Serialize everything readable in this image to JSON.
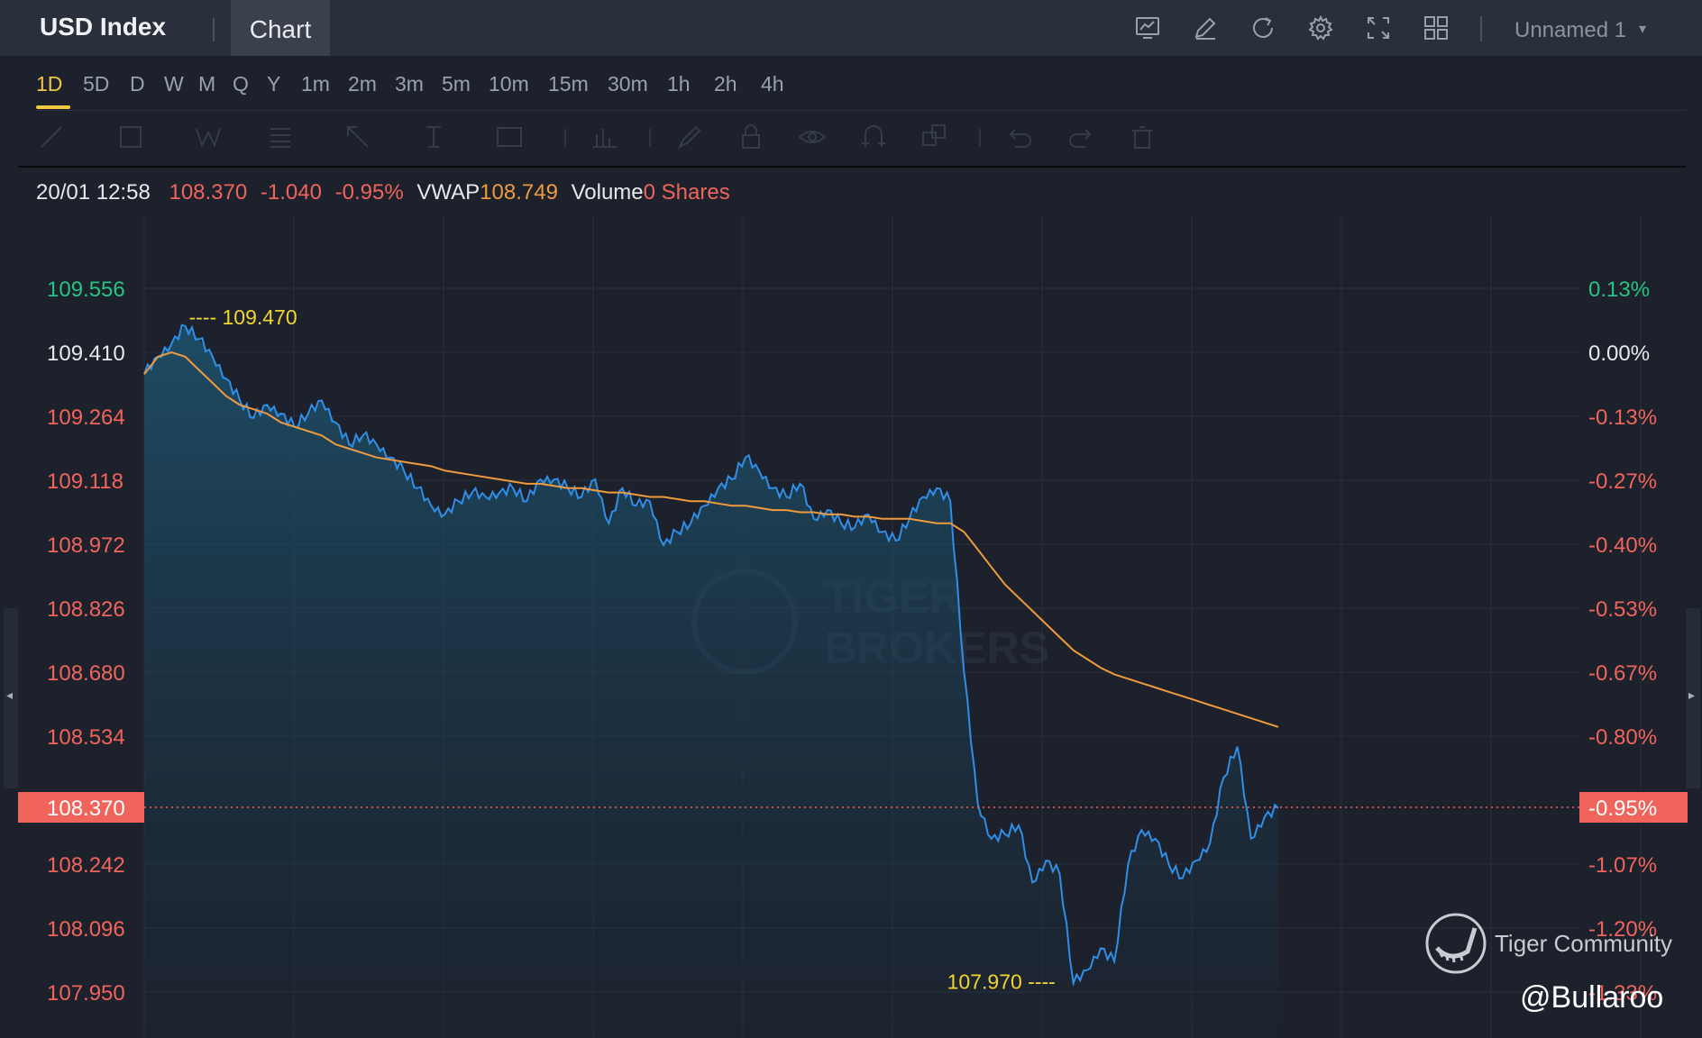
{
  "header": {
    "title": "USD Index",
    "tab_label": "Chart",
    "layout_name": "Unnamed 1",
    "icons": [
      "chart-template-icon",
      "pencil-icon",
      "refresh-icon",
      "settings-icon",
      "fullscreen-icon",
      "grid-layout-icon"
    ]
  },
  "timeframes": [
    "1D",
    "5D",
    "D",
    "W",
    "M",
    "Q",
    "Y",
    "1m",
    "2m",
    "3m",
    "5m",
    "10m",
    "15m",
    "30m",
    "1h",
    "2h",
    "4h"
  ],
  "active_timeframe": "1D",
  "drawing_tools": [
    "trend-line-icon",
    "rectangle-icon",
    "pattern-icon",
    "fib-icon",
    "arrow-icon",
    "text-cursor-icon",
    "annotation-icon",
    "indicator-icon",
    "brush-icon",
    "lock-icon",
    "eye-icon",
    "magnet-icon",
    "layers-icon",
    "undo-icon",
    "redo-icon",
    "trash-icon"
  ],
  "legend": {
    "time": "20/01 12:58",
    "price": "108.370",
    "change": "-1.040",
    "change_pct": "-0.95%",
    "vwap_label": "VWAP",
    "vwap_value": "108.749",
    "volume_label": "Volume",
    "volume_value": "0 Shares"
  },
  "colors": {
    "price_line": "#2f8fe8",
    "vwap_line": "#f09a3e",
    "up": "#27c285",
    "down": "#f0645c",
    "marker": "#f2d52e",
    "background": "#1c212b"
  },
  "chart_data": {
    "type": "area",
    "ylim": [
      107.95,
      109.556
    ],
    "y_ticks": [
      "109.556",
      "109.410",
      "109.264",
      "109.118",
      "108.972",
      "108.826",
      "108.680",
      "108.534",
      "108.242",
      "108.096",
      "107.950"
    ],
    "pct_ticks": [
      "0.13%",
      "0.00%",
      "-0.13%",
      "-0.27%",
      "-0.40%",
      "-0.53%",
      "-0.67%",
      "-0.80%",
      "-1.07%",
      "-1.20%",
      "-1.33%"
    ],
    "current_price": "108.370",
    "current_pct": "-0.95%",
    "high_label": "109.470",
    "low_label": "107.970",
    "series": [
      {
        "name": "USD Index",
        "values": [
          109.36,
          109.4,
          109.43,
          109.47,
          109.44,
          109.4,
          109.35,
          109.3,
          109.26,
          109.29,
          109.27,
          109.24,
          109.27,
          109.3,
          109.25,
          109.2,
          109.22,
          109.2,
          109.17,
          109.14,
          109.1,
          109.06,
          109.04,
          109.07,
          109.09,
          109.08,
          109.09,
          109.1,
          109.07,
          109.12,
          109.12,
          109.1,
          109.08,
          109.12,
          109.02,
          109.1,
          109.06,
          109.07,
          108.97,
          109.0,
          109.02,
          109.06,
          109.1,
          109.12,
          109.17,
          109.14,
          109.1,
          109.08,
          109.11,
          109.03,
          109.05,
          109.02,
          109.01,
          109.04,
          109.0,
          108.98,
          109.03,
          109.08,
          109.1,
          109.07,
          108.68,
          108.38,
          108.3,
          108.31,
          108.33,
          108.2,
          108.25,
          108.22,
          107.97,
          108.0,
          108.05,
          108.02,
          108.24,
          108.32,
          108.3,
          108.24,
          108.21,
          108.25,
          108.29,
          108.44,
          108.51,
          108.3,
          108.35,
          108.37
        ]
      },
      {
        "name": "VWAP",
        "values": [
          109.36,
          109.4,
          109.41,
          109.4,
          109.37,
          109.34,
          109.31,
          109.29,
          109.28,
          109.27,
          109.25,
          109.24,
          109.23,
          109.22,
          109.2,
          109.19,
          109.18,
          109.17,
          109.165,
          109.16,
          109.155,
          109.15,
          109.14,
          109.135,
          109.13,
          109.125,
          109.12,
          109.115,
          109.11,
          109.11,
          109.105,
          109.1,
          109.1,
          109.095,
          109.09,
          109.09,
          109.085,
          109.08,
          109.08,
          109.075,
          109.07,
          109.07,
          109.065,
          109.06,
          109.06,
          109.055,
          109.05,
          109.05,
          109.045,
          109.045,
          109.04,
          109.04,
          109.035,
          109.035,
          109.03,
          109.03,
          109.03,
          109.025,
          109.02,
          109.02,
          109.0,
          108.96,
          108.92,
          108.88,
          108.85,
          108.82,
          108.79,
          108.76,
          108.73,
          108.71,
          108.69,
          108.675,
          108.665,
          108.655,
          108.645,
          108.635,
          108.625,
          108.615,
          108.605,
          108.595,
          108.585,
          108.575,
          108.565,
          108.555
        ]
      }
    ],
    "grid": true
  },
  "watermark": "TIGER BROKERS",
  "community_label": "Tiger Community",
  "handle": "@Bullaroo"
}
